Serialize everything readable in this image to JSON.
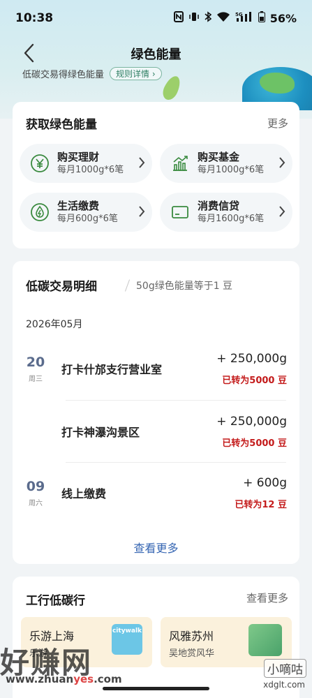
{
  "status_bar": {
    "time": "10:38",
    "battery": "56%",
    "signal_label": "5G"
  },
  "nav": {
    "title": "绿色能量"
  },
  "banner": {
    "text": "低碳交易得绿色能量",
    "rules_label": "规则详情 ›"
  },
  "earn_card": {
    "title": "获取绿色能量",
    "more_label": "更多",
    "tiles": [
      {
        "icon": "yen-circle-icon",
        "title": "购买理财",
        "subtitle": "每月1000g*6笔"
      },
      {
        "icon": "growth-chart-icon",
        "title": "购买基金",
        "subtitle": "每月1000g*6笔"
      },
      {
        "icon": "utility-drop-icon",
        "title": "生活缴费",
        "subtitle": "每月600g*6笔"
      },
      {
        "icon": "credit-card-icon",
        "title": "消费信贷",
        "subtitle": "每月1600g*6笔"
      }
    ]
  },
  "transactions": {
    "title": "低碳交易明细",
    "subtitle": "50g绿色能量等于1 豆",
    "month": "2026年05月",
    "items": [
      {
        "day": "20",
        "weekday": "周三",
        "name": "打卡什邡支行营业室",
        "amount": "+ 250,000g",
        "converted": "已转为5000 豆"
      },
      {
        "day": "",
        "weekday": "",
        "name": "打卡神瀑沟景区",
        "amount": "+ 250,000g",
        "converted": "已转为5000 豆"
      },
      {
        "day": "09",
        "weekday": "周六",
        "name": "线上缴费",
        "amount": "+ 600g",
        "converted": "已转为12 豆"
      }
    ],
    "see_more_label": "查看更多"
  },
  "low_carbon": {
    "title": "工行低碳行",
    "more_label": "查看更多",
    "promos": [
      {
        "title": "乐游上海",
        "subtitle": "乐游",
        "badge": "citywalk"
      },
      {
        "title": "风雅苏州",
        "subtitle": "吴地赏风华"
      }
    ]
  },
  "watermark": {
    "brand": "好赚网",
    "url_prefix": "www.zhuan",
    "url_highlight": "yes",
    "url_suffix": ".com",
    "brand2": "小嘀咕",
    "url2": "xdglt.com"
  },
  "colors": {
    "accent_red": "#c41b1b",
    "link_blue": "#3767b3",
    "icon_green": "#3a8a3f"
  }
}
